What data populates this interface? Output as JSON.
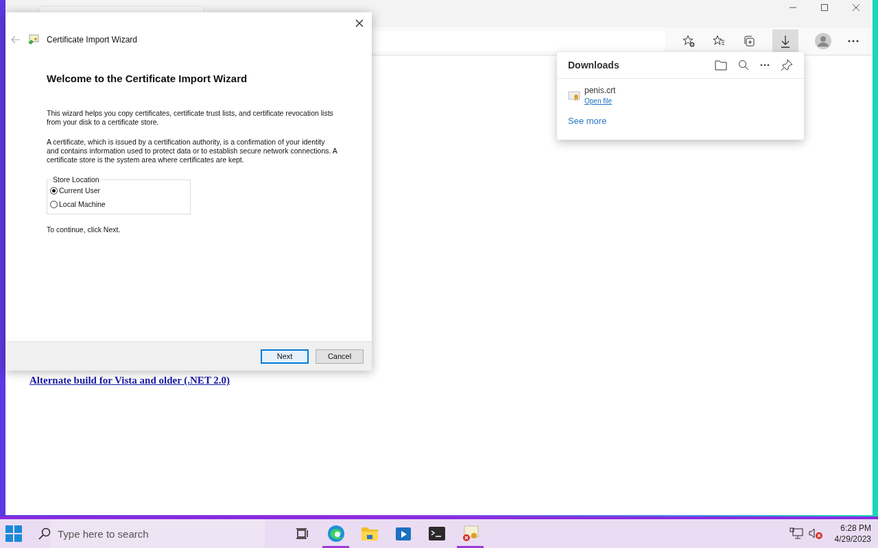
{
  "page": {
    "link": "Alternate build for Vista and older (.NET 2.0)"
  },
  "downloads": {
    "title": "Downloads",
    "items": [
      {
        "name": "penis.crt",
        "action": "Open file"
      }
    ],
    "see_more": "See more"
  },
  "wizard": {
    "title": "Certificate Import Wizard",
    "heading": "Welcome to the Certificate Import Wizard",
    "paragraphs": [
      "This wizard helps you copy certificates, certificate trust lists, and certificate revocation lists from your disk to a certificate store.",
      "A certificate, which is issued by a certification authority, is a confirmation of your identity and contains information used to protect data or to establish secure network connections. A certificate store is the system area where certificates are kept."
    ],
    "store_location": {
      "legend": "Store Location",
      "options": [
        {
          "label": "Current User",
          "selected": true
        },
        {
          "label": "Local Machine",
          "selected": false
        }
      ]
    },
    "hint": "To continue, click Next.",
    "buttons": [
      {
        "label": "Next",
        "kind": "default"
      },
      {
        "label": "Cancel",
        "kind": "normal"
      }
    ]
  },
  "taskbar": {
    "search_placeholder": "Type here to search",
    "apps": [
      {
        "kind": "taskview",
        "running": false
      },
      {
        "kind": "edge",
        "running": true
      },
      {
        "kind": "folder",
        "running": false
      },
      {
        "kind": "media",
        "running": false
      },
      {
        "kind": "terminal",
        "running": false
      },
      {
        "kind": "certificate",
        "running": true
      }
    ],
    "time": "6:28 PM",
    "date": "4/29/2023"
  }
}
